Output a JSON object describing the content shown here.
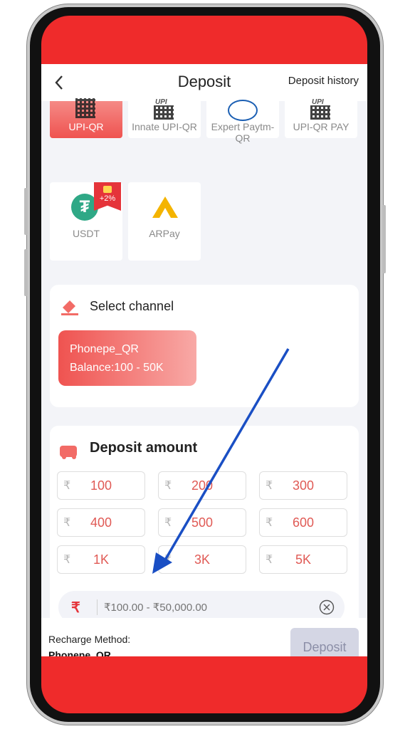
{
  "header": {
    "title": "Deposit",
    "history_label": "Deposit history"
  },
  "methods": [
    {
      "label": "UPI-QR",
      "mark": "UPI",
      "active": true
    },
    {
      "label": "Innate UPI-QR",
      "mark": "UPI",
      "active": false
    },
    {
      "label": "Expert Paytm-QR",
      "mark": "Paytm",
      "active": false
    },
    {
      "label": "UPI-QR PAY",
      "mark": "UPI",
      "active": false
    },
    {
      "label": "USDT",
      "badge": "+2%",
      "active": false
    },
    {
      "label": "ARPay",
      "active": false
    }
  ],
  "channel": {
    "title": "Select channel",
    "option": {
      "name": "Phonepe_QR",
      "balance": "Balance:100 - 50K"
    }
  },
  "amount": {
    "title": "Deposit amount",
    "currency_symbol": "₹",
    "options": [
      "100",
      "200",
      "300",
      "400",
      "500",
      "600",
      "1K",
      "3K",
      "5K"
    ],
    "input_placeholder": "₹100.00 - ₹50,000.00"
  },
  "footer": {
    "method_label": "Recharge Method:",
    "method_value": "Phonepe_QR",
    "deposit_label": "Deposit"
  },
  "colors": {
    "accent": "#ef5350",
    "frame_red": "#ef2b2b",
    "arrow": "#1a4fc4",
    "disabled_button": "#d4d6e4"
  }
}
